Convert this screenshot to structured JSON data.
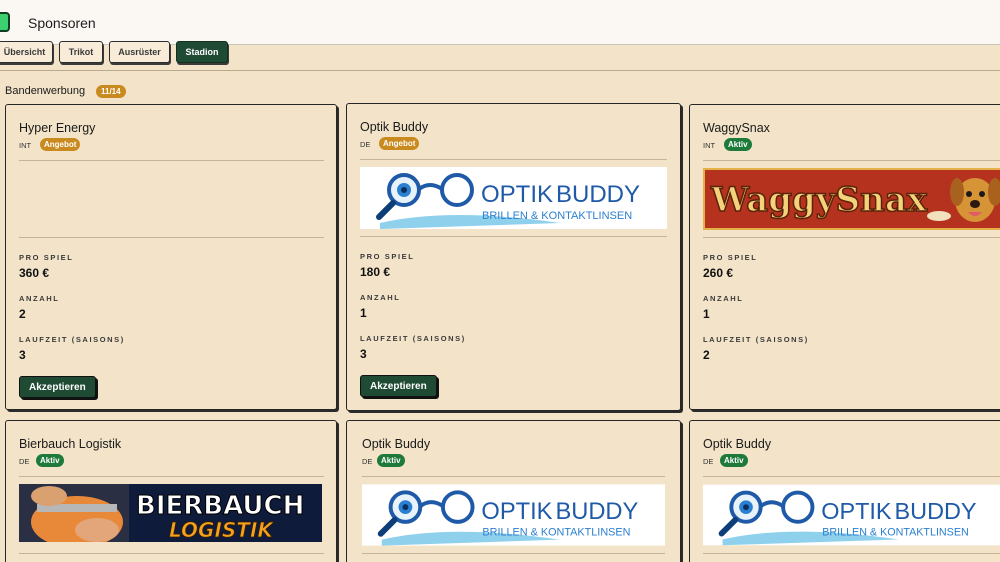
{
  "header": {
    "title": "Sponsoren"
  },
  "tabs": [
    {
      "label": "Übersicht",
      "active": false
    },
    {
      "label": "Trikot",
      "active": false
    },
    {
      "label": "Ausrüster",
      "active": false
    },
    {
      "label": "Stadion",
      "active": true
    }
  ],
  "section": {
    "title": "Bandenwerbung",
    "count": "11/14"
  },
  "labels": {
    "per_game": "PRO SPIEL",
    "amount": "ANZAHL",
    "duration": "LAUFZEIT (SAISONS)",
    "accept": "Akzeptieren"
  },
  "cards": [
    {
      "name": "Hyper Energy",
      "region": "INT",
      "status": "Angebot",
      "per_game": "360 €",
      "amount": "2",
      "duration": "3"
    },
    {
      "name": "Optik Buddy",
      "region": "DE",
      "status": "Angebot",
      "per_game": "180 €",
      "amount": "1",
      "duration": "3",
      "logo": {
        "main_left": "OPTIK",
        "main_right": "BUDDY",
        "sub": "BRILLEN & KONTAKTLINSEN"
      }
    },
    {
      "name": "WaggySnax",
      "region": "INT",
      "status": "Aktiv",
      "per_game": "260 €",
      "amount": "1",
      "duration": "2",
      "logo": {
        "main": "WaggySnax"
      }
    },
    {
      "name": "Bierbauch Logistik",
      "region": "DE",
      "status": "Aktiv",
      "logo": {
        "line1": "BIERBAUCH",
        "line2": "LOGISTIK"
      }
    },
    {
      "name": "Optik Buddy",
      "region": "DE",
      "status": "Aktiv",
      "logo": {
        "main_left": "OPTIK",
        "main_right": "BUDDY",
        "sub": "BRILLEN & KONTAKTLINSEN"
      }
    },
    {
      "name": "Optik Buddy",
      "region": "DE",
      "status": "Aktiv",
      "logo": {
        "main_left": "OPTIK",
        "main_right": "BUDDY",
        "sub": "BRILLEN & KONTAKTLINSEN"
      }
    }
  ],
  "colors": {
    "background": "#f3e4c9",
    "accent": "#1f4a34",
    "offer": "#c98a1f",
    "active": "#1e7a3a",
    "optik_blue": "#1f5aa8"
  },
  "icons": [
    "app-icon",
    "glasses-icon",
    "magnifier-icon",
    "dog-icon",
    "worker-icon"
  ]
}
